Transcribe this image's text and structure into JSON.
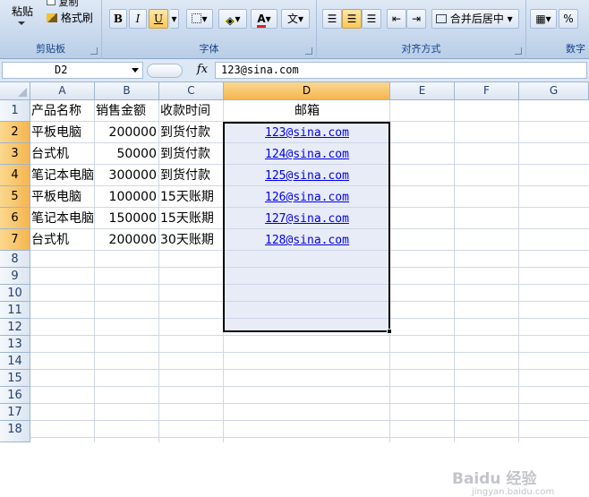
{
  "ribbon": {
    "clipboard": {
      "paste_label": "粘贴",
      "copy_label": "复制",
      "format_painter_label": "格式刷",
      "group_label": "剪贴板"
    },
    "font": {
      "bold": "B",
      "italic": "I",
      "underline": "U",
      "font_color_glyph": "A",
      "phonetic_glyph": "文",
      "group_label": "字体"
    },
    "alignment": {
      "merge_center_label": "合并后居中",
      "group_label": "对齐方式"
    },
    "number": {
      "percent": "%",
      "group_label": "数字"
    }
  },
  "formula_bar": {
    "name_box": "D2",
    "fx": "fx",
    "content": "123@sina.com"
  },
  "sheet": {
    "columns": [
      "A",
      "B",
      "C",
      "D",
      "E",
      "F",
      "G"
    ],
    "selected_column": "D",
    "rows": [
      "1",
      "2",
      "3",
      "4",
      "5",
      "6",
      "7",
      "8",
      "9",
      "10",
      "11",
      "12",
      "13",
      "14",
      "15",
      "16",
      "17",
      "18"
    ],
    "headers": [
      "产品名称",
      "销售金额",
      "收款时间",
      "邮箱"
    ],
    "data": [
      {
        "product": "平板电脑",
        "amount": "200000",
        "payment": "到货付款",
        "email": "123@sina.com"
      },
      {
        "product": "台式机",
        "amount": "50000",
        "payment": "到货付款",
        "email": "124@sina.com"
      },
      {
        "product": "笔记本电脑",
        "amount": "300000",
        "payment": "到货付款",
        "email": "125@sina.com"
      },
      {
        "product": "平板电脑",
        "amount": "100000",
        "payment": "15天账期",
        "email": "126@sina.com"
      },
      {
        "product": "笔记本电脑",
        "amount": "150000",
        "payment": "15天账期",
        "email": "127@sina.com"
      },
      {
        "product": "台式机",
        "amount": "200000",
        "payment": "30天账期",
        "email": "128@sina.com"
      }
    ]
  },
  "watermark": {
    "brand": "Baidu 经验",
    "url": "jingyan.baidu.com"
  },
  "colors": {
    "ribbon_bg": "#c4d6ec",
    "header_selected": "#f5b550",
    "hyperlink": "#0000ee",
    "selection_fill": "#cbd5eb"
  }
}
